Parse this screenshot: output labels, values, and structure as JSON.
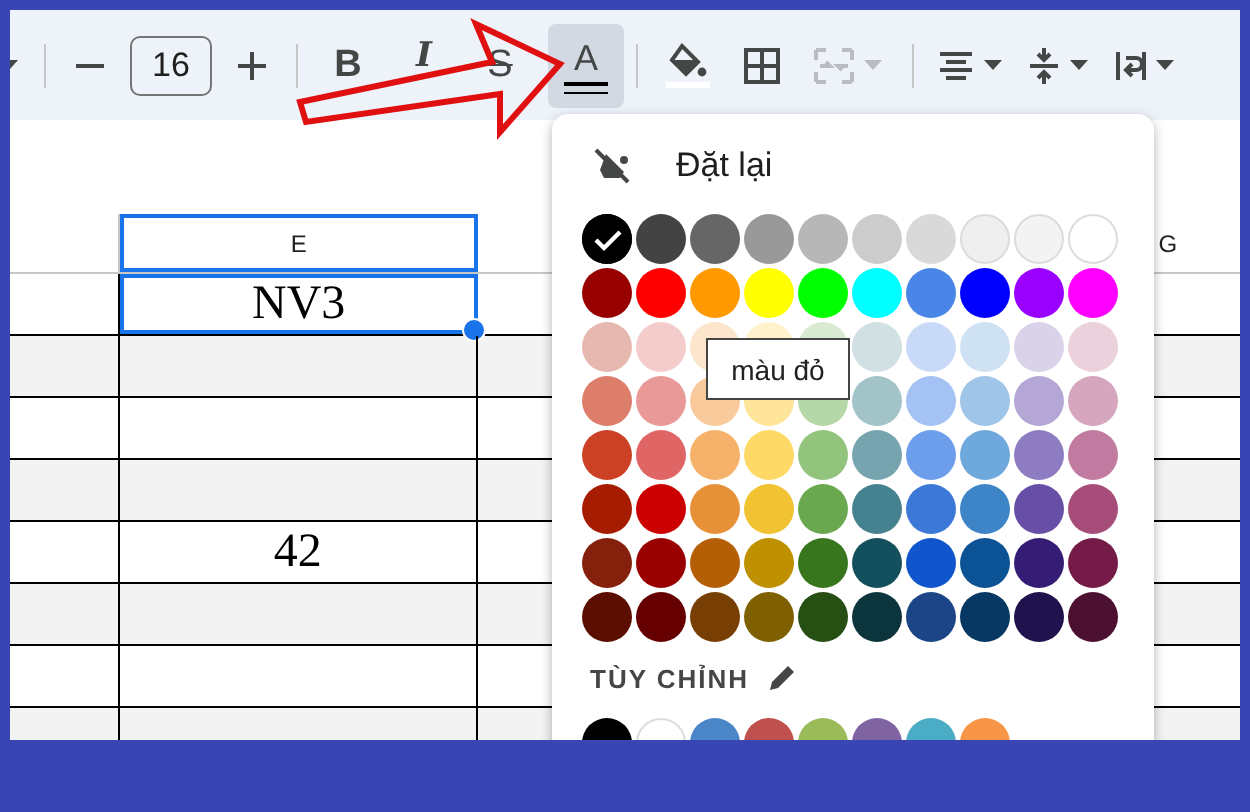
{
  "toolbar": {
    "groups": [
      [
        {
          "kind": "caret",
          "active": false,
          "disabled": false
        }
      ],
      [
        {
          "kind": "minus",
          "active": false,
          "disabled": false
        },
        {
          "kind": "font_size",
          "value": "16"
        },
        {
          "kind": "plus",
          "active": false,
          "disabled": false
        }
      ],
      [
        {
          "kind": "bold",
          "label": "B",
          "active": false,
          "disabled": false
        },
        {
          "kind": "italic",
          "label": "I",
          "active": false,
          "disabled": false
        },
        {
          "kind": "strike",
          "label": "S",
          "active": false,
          "disabled": false
        },
        {
          "kind": "text_color",
          "label": "A",
          "active": true,
          "disabled": false
        }
      ],
      [
        {
          "kind": "fill",
          "active": false,
          "disabled": false
        },
        {
          "kind": "borders",
          "active": false,
          "disabled": false
        },
        {
          "kind": "merge",
          "active": false,
          "disabled": true
        }
      ],
      [
        {
          "kind": "halign",
          "active": false,
          "disabled": false
        },
        {
          "kind": "valign",
          "active": false,
          "disabled": false
        },
        {
          "kind": "wrap",
          "active": false,
          "disabled": false
        }
      ]
    ]
  },
  "grid": {
    "columns": [
      {
        "label": "E",
        "selected": true
      },
      {
        "label": "G",
        "selected": false
      }
    ],
    "rows": [
      {
        "selected": true,
        "value": "NV3"
      },
      {
        "selected": false
      },
      {
        "selected": false
      },
      {
        "selected": false
      },
      {
        "selected": false,
        "value": "42"
      },
      {
        "selected": false
      },
      {
        "selected": false
      },
      {
        "selected": false
      }
    ]
  },
  "color_menu": {
    "reset": {
      "label": "Đặt lại"
    },
    "palette": [
      [
        {
          "color": "#000000",
          "selected": true
        },
        {
          "color": "#434343",
          "selected": false
        },
        {
          "color": "#666666",
          "selected": false
        },
        {
          "color": "#999999",
          "selected": false
        },
        {
          "color": "#b7b7b7",
          "selected": false
        },
        {
          "color": "#cccccc",
          "selected": false
        },
        {
          "color": "#d9d9d9",
          "selected": false
        },
        {
          "color": "#efefef",
          "selected": false
        },
        {
          "color": "#f3f3f3",
          "selected": false
        },
        {
          "color": "#ffffff",
          "selected": false
        }
      ],
      [
        {
          "color": "#980000",
          "selected": false
        },
        {
          "color": "#ff0000",
          "selected": false
        },
        {
          "color": "#ff9900",
          "selected": false
        },
        {
          "color": "#ffff00",
          "selected": false
        },
        {
          "color": "#00ff00",
          "selected": false
        },
        {
          "color": "#00ffff",
          "selected": false
        },
        {
          "color": "#4a86e8",
          "selected": false
        },
        {
          "color": "#0000ff",
          "selected": false
        },
        {
          "color": "#9900ff",
          "selected": false
        },
        {
          "color": "#ff00ff",
          "selected": false
        }
      ],
      [
        {
          "color": "#e6b8af",
          "selected": false
        },
        {
          "color": "#f4cccc",
          "selected": false
        },
        {
          "color": "#fce5cd",
          "selected": false
        },
        {
          "color": "#fff2cc",
          "selected": false
        },
        {
          "color": "#d9ead3",
          "selected": false
        },
        {
          "color": "#d0e0e3",
          "selected": false
        },
        {
          "color": "#c9daf8",
          "selected": false
        },
        {
          "color": "#cfe2f3",
          "selected": false
        },
        {
          "color": "#d9d2e9",
          "selected": false
        },
        {
          "color": "#ead1dc",
          "selected": false
        }
      ],
      [
        {
          "color": "#dd7e6b",
          "selected": false
        },
        {
          "color": "#ea9999",
          "selected": false
        },
        {
          "color": "#f9cb9c",
          "selected": false
        },
        {
          "color": "#ffe599",
          "selected": false
        },
        {
          "color": "#b6d7a8",
          "selected": false
        },
        {
          "color": "#a2c4c9",
          "selected": false
        },
        {
          "color": "#a4c2f4",
          "selected": false
        },
        {
          "color": "#9fc5e8",
          "selected": false
        },
        {
          "color": "#b4a7d6",
          "selected": false
        },
        {
          "color": "#d5a6bd",
          "selected": false
        }
      ],
      [
        {
          "color": "#cc4125",
          "selected": false
        },
        {
          "color": "#e06666",
          "selected": false
        },
        {
          "color": "#f6b26b",
          "selected": false
        },
        {
          "color": "#ffd966",
          "selected": false
        },
        {
          "color": "#93c47d",
          "selected": false
        },
        {
          "color": "#76a5af",
          "selected": false
        },
        {
          "color": "#6d9eeb",
          "selected": false
        },
        {
          "color": "#6fa8dc",
          "selected": false
        },
        {
          "color": "#8e7cc3",
          "selected": false
        },
        {
          "color": "#c27ba0",
          "selected": false
        }
      ],
      [
        {
          "color": "#a61c00",
          "selected": false
        },
        {
          "color": "#cc0000",
          "selected": false
        },
        {
          "color": "#e69138",
          "selected": false
        },
        {
          "color": "#f1c232",
          "selected": false
        },
        {
          "color": "#6aa84f",
          "selected": false
        },
        {
          "color": "#45818e",
          "selected": false
        },
        {
          "color": "#3c78d8",
          "selected": false
        },
        {
          "color": "#3d85c6",
          "selected": false
        },
        {
          "color": "#674ea7",
          "selected": false
        },
        {
          "color": "#a64d79",
          "selected": false
        }
      ],
      [
        {
          "color": "#85200c",
          "selected": false
        },
        {
          "color": "#990000",
          "selected": false
        },
        {
          "color": "#b45f06",
          "selected": false
        },
        {
          "color": "#bf9000",
          "selected": false
        },
        {
          "color": "#38761d",
          "selected": false
        },
        {
          "color": "#134f5c",
          "selected": false
        },
        {
          "color": "#1155cc",
          "selected": false
        },
        {
          "color": "#0b5394",
          "selected": false
        },
        {
          "color": "#351c75",
          "selected": false
        },
        {
          "color": "#741b47",
          "selected": false
        }
      ],
      [
        {
          "color": "#5b0f00",
          "selected": false
        },
        {
          "color": "#660000",
          "selected": false
        },
        {
          "color": "#783f04",
          "selected": false
        },
        {
          "color": "#7f6000",
          "selected": false
        },
        {
          "color": "#274e13",
          "selected": false
        },
        {
          "color": "#0c343d",
          "selected": false
        },
        {
          "color": "#1c4587",
          "selected": false
        },
        {
          "color": "#073763",
          "selected": false
        },
        {
          "color": "#20124d",
          "selected": false
        },
        {
          "color": "#4c1130",
          "selected": false
        }
      ]
    ],
    "custom": {
      "label": "TÙY CHỈNH",
      "swatches": [
        {
          "color": "#000000",
          "selected": false
        },
        {
          "color": "#ffffff",
          "selected": false
        },
        {
          "color": "#4a86c8",
          "selected": false
        },
        {
          "color": "#c0504d",
          "selected": false
        },
        {
          "color": "#9bbb59",
          "selected": false
        },
        {
          "color": "#8064a2",
          "selected": false
        },
        {
          "color": "#4bacc6",
          "selected": false
        },
        {
          "color": "#f79646",
          "selected": false
        }
      ]
    },
    "tooltip": {
      "text": "màu đỏ"
    }
  }
}
